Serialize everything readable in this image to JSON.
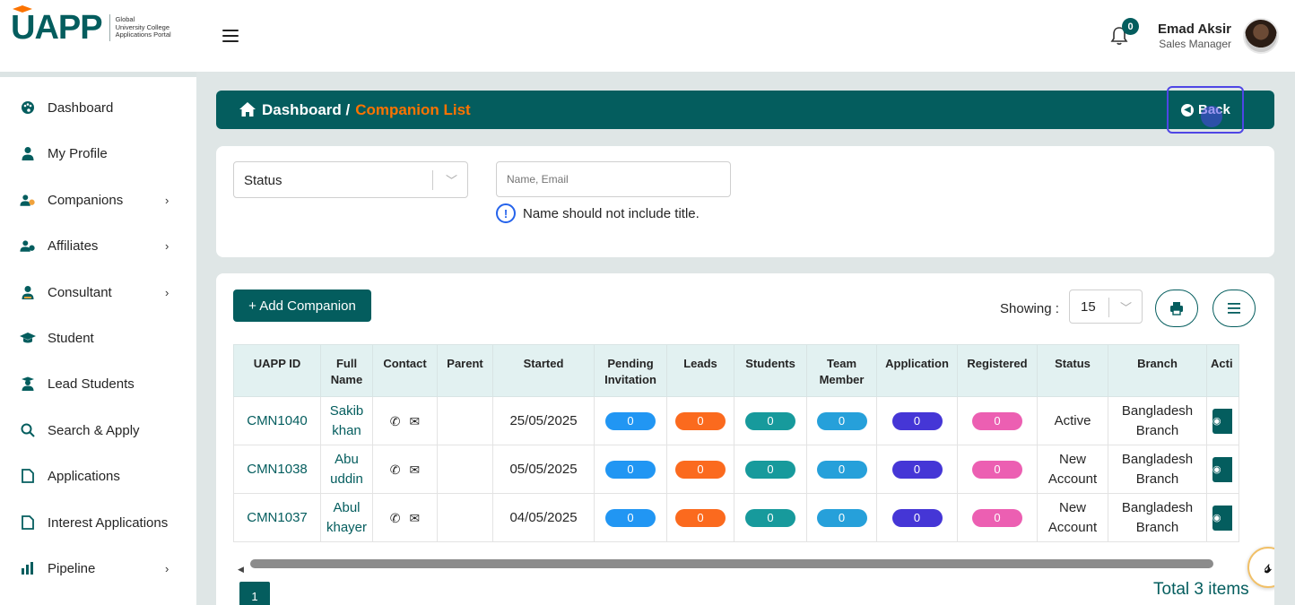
{
  "header": {
    "logo_text": "UAPP",
    "logo_sub": [
      "Global",
      "University College",
      "Applications Portal"
    ],
    "notification_count": "0",
    "user_name": "Emad Aksir",
    "user_role": "Sales Manager"
  },
  "sidebar": {
    "items": [
      {
        "label": "Dashboard",
        "icon": "palette-icon",
        "has_submenu": false
      },
      {
        "label": "My Profile",
        "icon": "user-icon",
        "has_submenu": false
      },
      {
        "label": "Companions",
        "icon": "users-icon",
        "has_submenu": true
      },
      {
        "label": "Affiliates",
        "icon": "users-icon",
        "has_submenu": true
      },
      {
        "label": "Consultant",
        "icon": "user-tie-icon",
        "has_submenu": true
      },
      {
        "label": "Student",
        "icon": "graduation-cap-icon",
        "has_submenu": false
      },
      {
        "label": "Lead Students",
        "icon": "user-graduate-icon",
        "has_submenu": false
      },
      {
        "label": "Search & Apply",
        "icon": "search-icon",
        "has_submenu": false
      },
      {
        "label": "Applications",
        "icon": "file-icon",
        "has_submenu": false
      },
      {
        "label": "Interest Applications",
        "icon": "file-icon",
        "has_submenu": false
      },
      {
        "label": "Pipeline",
        "icon": "bar-chart-icon",
        "has_submenu": true
      }
    ]
  },
  "breadcrumb": {
    "root": "Dashboard /",
    "current": "Companion List",
    "back_label": "Back"
  },
  "filters": {
    "status_value": "Status",
    "search_placeholder": "Name, Email",
    "hint": "Name should not include title."
  },
  "toolbar": {
    "add_label": "+ Add Companion",
    "showing_label": "Showing :",
    "page_size": "15"
  },
  "table": {
    "columns": [
      "UAPP ID",
      "Full Name",
      "Contact",
      "Parent",
      "Started",
      "Pending Invitation",
      "Leads",
      "Students",
      "Team Member",
      "Application",
      "Registered",
      "Status",
      "Branch",
      "Acti"
    ],
    "rows": [
      {
        "id": "CMN1040",
        "name": "Sakib khan",
        "parent": "",
        "started": "25/05/2025",
        "pending": "0",
        "leads": "0",
        "students": "0",
        "team": "0",
        "application": "0",
        "registered": "0",
        "status": "Active",
        "branch": "Bangladesh Branch"
      },
      {
        "id": "CMN1038",
        "name": "Abu uddin",
        "parent": "",
        "started": "05/05/2025",
        "pending": "0",
        "leads": "0",
        "students": "0",
        "team": "0",
        "application": "0",
        "registered": "0",
        "status": "New Account",
        "branch": "Bangladesh Branch"
      },
      {
        "id": "CMN1037",
        "name": "Abul khayer",
        "parent": "",
        "started": "04/05/2025",
        "pending": "0",
        "leads": "0",
        "students": "0",
        "team": "0",
        "application": "0",
        "registered": "0",
        "status": "New Account",
        "branch": "Bangladesh Branch"
      }
    ]
  },
  "pagination": {
    "current_page": "1",
    "total_label": "Total 3 items"
  },
  "colors": {
    "brand": "#045d5e",
    "accent_orange": "#fc7300",
    "pending": "#2196f3",
    "leads": "#fb6a1e",
    "students": "#179a9c",
    "team": "#26a0da",
    "application": "#4536d6",
    "registered": "#ec5fb2"
  }
}
